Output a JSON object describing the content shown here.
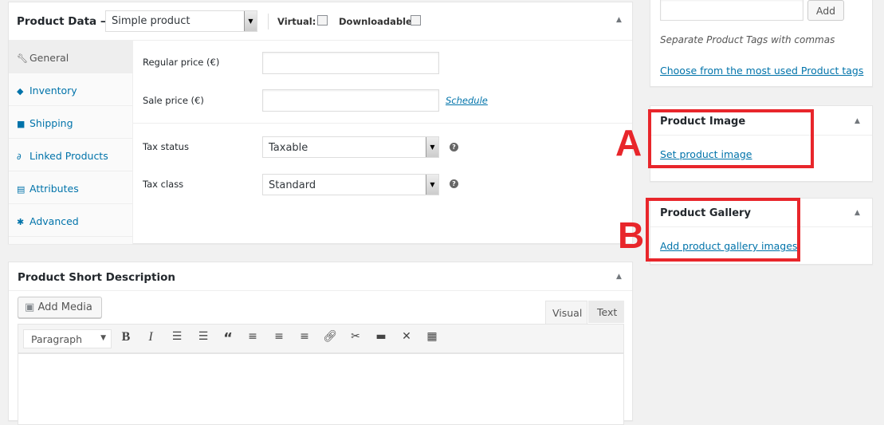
{
  "product_data": {
    "title": "Product Data —",
    "product_type": "Simple product",
    "virtual_label": "Virtual:",
    "downloadable_label": "Downloadable:",
    "tabs": [
      {
        "label": "General",
        "icon": "wrench-icon"
      },
      {
        "label": "Inventory",
        "icon": "tag-icon"
      },
      {
        "label": "Shipping",
        "icon": "truck-icon"
      },
      {
        "label": "Linked Products",
        "icon": "link-icon"
      },
      {
        "label": "Attributes",
        "icon": "list-icon"
      },
      {
        "label": "Advanced",
        "icon": "gear-icon"
      }
    ],
    "regular_price_label": "Regular price (€)",
    "regular_price_value": "",
    "sale_price_label": "Sale price (€)",
    "sale_price_value": "",
    "schedule_link": "Schedule",
    "tax_status_label": "Tax status",
    "tax_status_value": "Taxable",
    "tax_class_label": "Tax class",
    "tax_class_value": "Standard"
  },
  "short_description": {
    "title": "Product Short Description",
    "add_media": "Add Media",
    "tab_visual": "Visual",
    "tab_text": "Text",
    "format_select": "Paragraph"
  },
  "tags": {
    "add_button": "Add",
    "hint": "Separate Product Tags with commas",
    "choose_link": "Choose from the most used Product tags"
  },
  "product_image": {
    "title": "Product Image",
    "link": "Set product image",
    "annotation": "A"
  },
  "product_gallery": {
    "title": "Product Gallery",
    "link": "Add product gallery images",
    "annotation": "B"
  },
  "colors": {
    "link": "#0073aa",
    "annotation": "#e8262b"
  }
}
